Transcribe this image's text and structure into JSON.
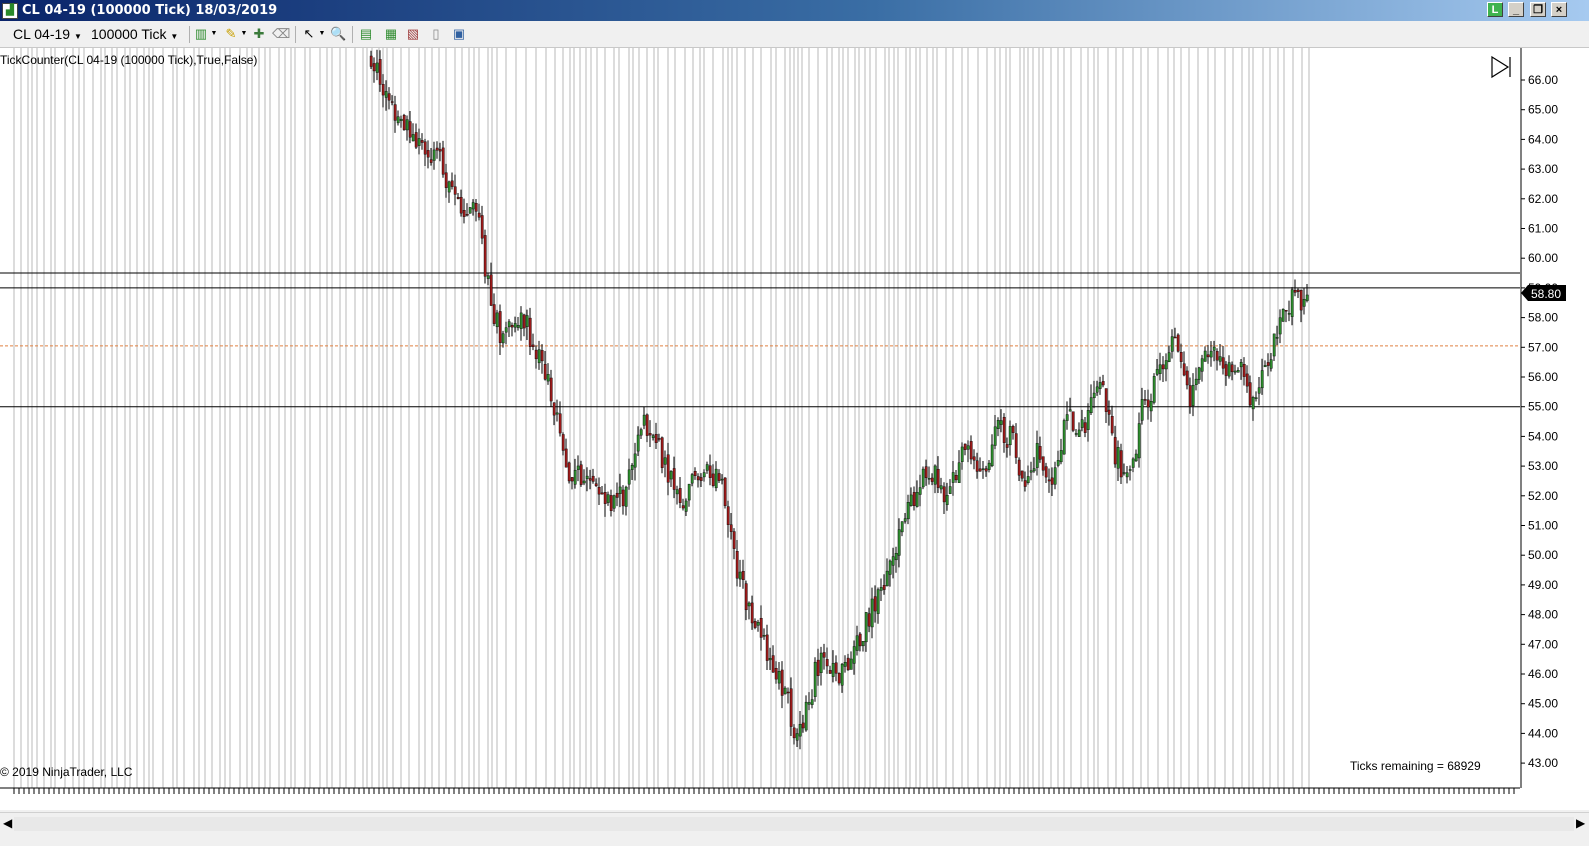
{
  "window": {
    "title": "CL 04-19 (100000 Tick)  18/03/2019",
    "controls": [
      "L",
      "_",
      "restore",
      "×"
    ]
  },
  "toolbar": {
    "instrument": "CL 04-19",
    "interval": "100000 Tick",
    "icons": [
      "bar-chart-icon",
      "pencil-icon",
      "crosshair-icon",
      "zoom-icon",
      "properties-icon"
    ]
  },
  "indicator_label": "TickCounter(CL 04-19  (100000  Tick),True,False)",
  "copyright": "© 2019 NinjaTrader, LLC",
  "ticks_remaining": "Ticks remaining = 68929",
  "price_marker": "58.80",
  "y_axis_labels": [
    "66.00",
    "65.00",
    "64.00",
    "63.00",
    "62.00",
    "61.00",
    "60.00",
    "59.00",
    "58.00",
    "57.00",
    "56.00",
    "55.00",
    "54.00",
    "53.00",
    "52.00",
    "51.00",
    "50.00",
    "49.00",
    "48.00",
    "47.00",
    "46.00",
    "45.00",
    "44.00",
    "43.00"
  ],
  "colors": {
    "up_candle": "#2e8b2e",
    "down_candle": "#9b1a1a",
    "wick": "#000000",
    "separator": "#b8b8b8",
    "dashed_line": "#e08040",
    "marker_bg": "#000000",
    "title_gradient_start": "#0a246a"
  },
  "chart_data": {
    "type": "candlestick",
    "title": "CL 04-19 (100000 Tick)",
    "ylim": [
      42.5,
      66.6
    ],
    "horizontal_lines": [
      59.5,
      59.0,
      55.0
    ],
    "dashed_line": 57.05,
    "last_price": 58.8,
    "series": [
      {
        "name": "CL 04-19",
        "path_points": [
          [
            0,
            66.8
          ],
          [
            3,
            65.2
          ],
          [
            7,
            64.0
          ],
          [
            10,
            63.2
          ],
          [
            13,
            61.5
          ],
          [
            15,
            62.0
          ],
          [
            17,
            59.0
          ],
          [
            19,
            57.0
          ],
          [
            21,
            58.3
          ],
          [
            23,
            57.5
          ],
          [
            26,
            55.5
          ],
          [
            29,
            52.5
          ],
          [
            32,
            52.8
          ],
          [
            35,
            51.5
          ],
          [
            37,
            52.2
          ],
          [
            39,
            54.6
          ],
          [
            42,
            53.5
          ],
          [
            45,
            51.8
          ],
          [
            48,
            53.0
          ],
          [
            51,
            52.3
          ],
          [
            53,
            49.5
          ],
          [
            56,
            47.5
          ],
          [
            60,
            45.5
          ],
          [
            62,
            43.6
          ],
          [
            65,
            46.5
          ],
          [
            68,
            46.0
          ],
          [
            71,
            47.2
          ],
          [
            74,
            49.0
          ],
          [
            78,
            51.5
          ],
          [
            81,
            53.0
          ],
          [
            83,
            52.0
          ],
          [
            86,
            53.5
          ],
          [
            89,
            52.7
          ],
          [
            91,
            54.5
          ],
          [
            93,
            53.8
          ],
          [
            95,
            52.5
          ],
          [
            97,
            53.5
          ],
          [
            99,
            52.2
          ],
          [
            101,
            55.0
          ],
          [
            103,
            54.0
          ],
          [
            106,
            55.8
          ],
          [
            108,
            53.5
          ],
          [
            110,
            52.3
          ],
          [
            112,
            55.0
          ],
          [
            115,
            56.5
          ],
          [
            117,
            57.3
          ],
          [
            119,
            55.3
          ],
          [
            122,
            57.0
          ],
          [
            124,
            56.0
          ],
          [
            126,
            56.5
          ],
          [
            128,
            55.0
          ],
          [
            131,
            57.0
          ],
          [
            133,
            58.5
          ],
          [
            136,
            58.8
          ]
        ]
      }
    ]
  }
}
